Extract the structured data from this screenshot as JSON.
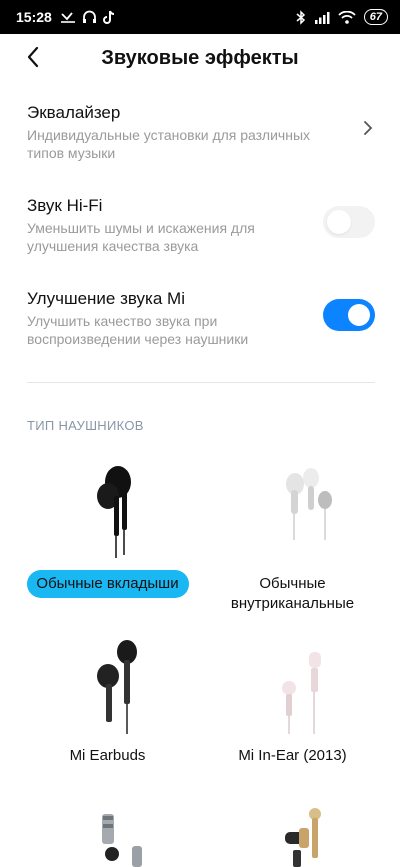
{
  "status_bar": {
    "time": "15:28",
    "battery": "67"
  },
  "header": {
    "title": "Звуковые эффекты"
  },
  "settings": [
    {
      "title": "Эквалайзер",
      "description": "Индивидуальные установки для различных типов музыки",
      "control": "chevron"
    },
    {
      "title": "Звук Hi-Fi",
      "description": "Уменьшить шумы и искажения для улучшения качества звука",
      "control": "toggle",
      "enabled": false
    },
    {
      "title": "Улучшение звука Mi",
      "description": "Улучшить качество звука при воспроизведении через наушники",
      "control": "toggle",
      "enabled": true
    }
  ],
  "headphones": {
    "section_label": "ТИП НАУШНИКОВ",
    "items": [
      {
        "label": "Обычные вкладыши",
        "selected": true,
        "color": "#111111"
      },
      {
        "label": "Обычные внутриканальные",
        "selected": false,
        "color": "#d9d9d9"
      },
      {
        "label": "Mi Earbuds",
        "selected": false,
        "color": "#1a1a1a"
      },
      {
        "label": "Mi In-Ear (2013)",
        "selected": false,
        "color": "#f2e4e6"
      },
      {
        "label": "",
        "selected": false,
        "color": "#9aa0a6"
      },
      {
        "label": "",
        "selected": false,
        "color": "#c8a46a"
      }
    ]
  },
  "colors": {
    "accent": "#0d84ff",
    "selected_chip": "#1ab8f2"
  }
}
